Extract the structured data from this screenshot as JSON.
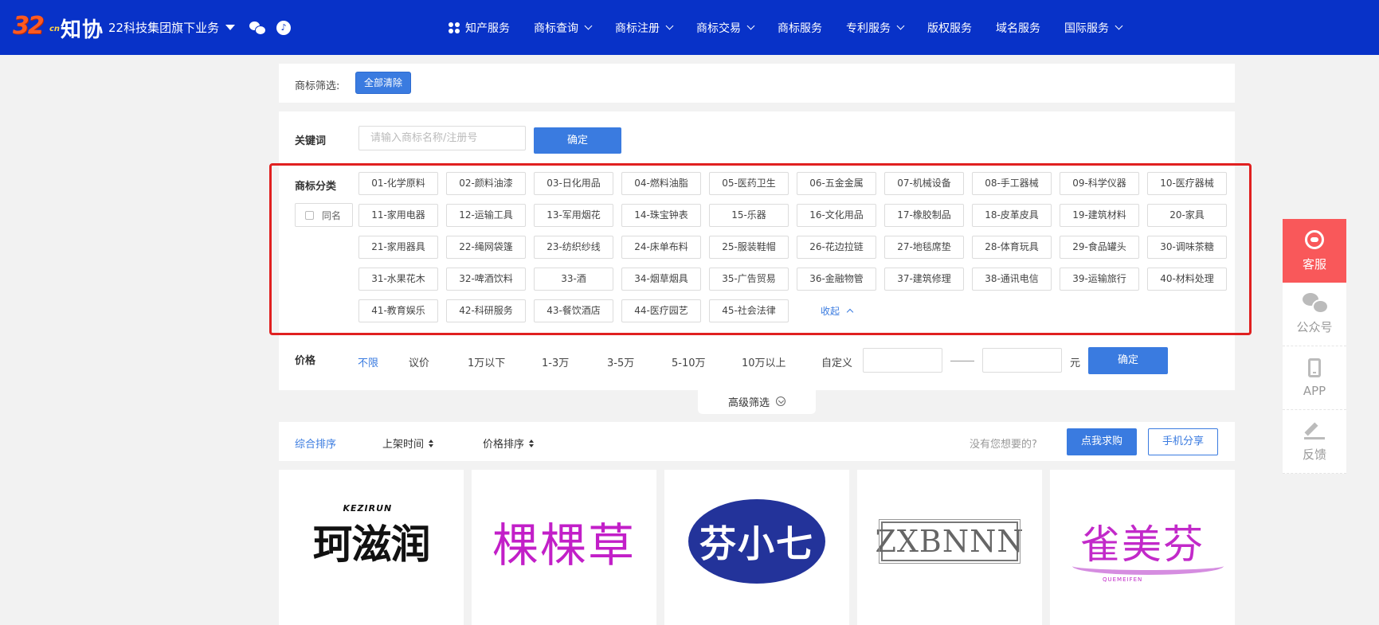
{
  "header": {
    "logo_number": "32",
    "logo_suffix": "cn",
    "logo_text": "知协",
    "group_label": "22科技集团旗下业务",
    "nav": [
      {
        "label": "知产服务",
        "dropdown": false
      },
      {
        "label": "商标查询",
        "dropdown": true
      },
      {
        "label": "商标注册",
        "dropdown": true
      },
      {
        "label": "商标交易",
        "dropdown": true
      },
      {
        "label": "商标服务",
        "dropdown": false
      },
      {
        "label": "专利服务",
        "dropdown": true
      },
      {
        "label": "版权服务",
        "dropdown": false
      },
      {
        "label": "域名服务",
        "dropdown": false
      },
      {
        "label": "国际服务",
        "dropdown": true
      }
    ]
  },
  "filter": {
    "label": "商标筛选:",
    "clear_label": "全部清除"
  },
  "keyword": {
    "label": "关键词",
    "placeholder": "请输入商标名称/注册号",
    "value": "",
    "confirm_label": "确定"
  },
  "category": {
    "label": "商标分类",
    "same_name_label": "同名",
    "collapse_label": "收起",
    "items": [
      "01-化学原料",
      "02-颜料油漆",
      "03-日化用品",
      "04-燃料油脂",
      "05-医药卫生",
      "06-五金金属",
      "07-机械设备",
      "08-手工器械",
      "09-科学仪器",
      "10-医疗器械",
      "11-家用电器",
      "12-运输工具",
      "13-军用烟花",
      "14-珠宝钟表",
      "15-乐器",
      "16-文化用品",
      "17-橡胶制品",
      "18-皮革皮具",
      "19-建筑材料",
      "20-家具",
      "21-家用器具",
      "22-绳网袋篷",
      "23-纺织纱线",
      "24-床单布料",
      "25-服装鞋帽",
      "26-花边拉链",
      "27-地毯席垫",
      "28-体育玩具",
      "29-食品罐头",
      "30-调味茶糖",
      "31-水果花木",
      "32-啤酒饮料",
      "33-酒",
      "34-烟草烟具",
      "35-广告贸易",
      "36-金融物管",
      "37-建筑修理",
      "38-通讯电信",
      "39-运输旅行",
      "40-材料处理",
      "41-教育娱乐",
      "42-科研服务",
      "43-餐饮酒店",
      "44-医疗园艺",
      "45-社会法律"
    ]
  },
  "price": {
    "label": "价格",
    "options": [
      "不限",
      "议价",
      "1万以下",
      "1-3万",
      "3-5万",
      "5-10万",
      "10万以上"
    ],
    "active_index": 0,
    "custom_label": "自定义",
    "unit": "元",
    "confirm_label": "确定"
  },
  "advanced_label": "高级筛选",
  "sortbar": {
    "sorts": [
      "综合排序",
      "上架时间",
      "价格排序"
    ],
    "active_index": 0,
    "question": "没有您想要的?",
    "buy_label": "点我求购",
    "share_label": "手机分享"
  },
  "cards": [
    {
      "brand": "珂滋润",
      "sub": "KEZIRUN"
    },
    {
      "brand": "棵棵草"
    },
    {
      "brand": "芬小七"
    },
    {
      "brand": "ZXBNNN"
    },
    {
      "brand": "雀美芬",
      "sub": "QUEMEIFEN"
    }
  ],
  "float_bar": {
    "items": [
      "客服",
      "公众号",
      "APP",
      "反馈"
    ]
  },
  "colors": {
    "header_bg": "#0832c8",
    "accent": "#3a7be0",
    "highlight_border": "#e02020",
    "service_red": "#f9585a"
  }
}
